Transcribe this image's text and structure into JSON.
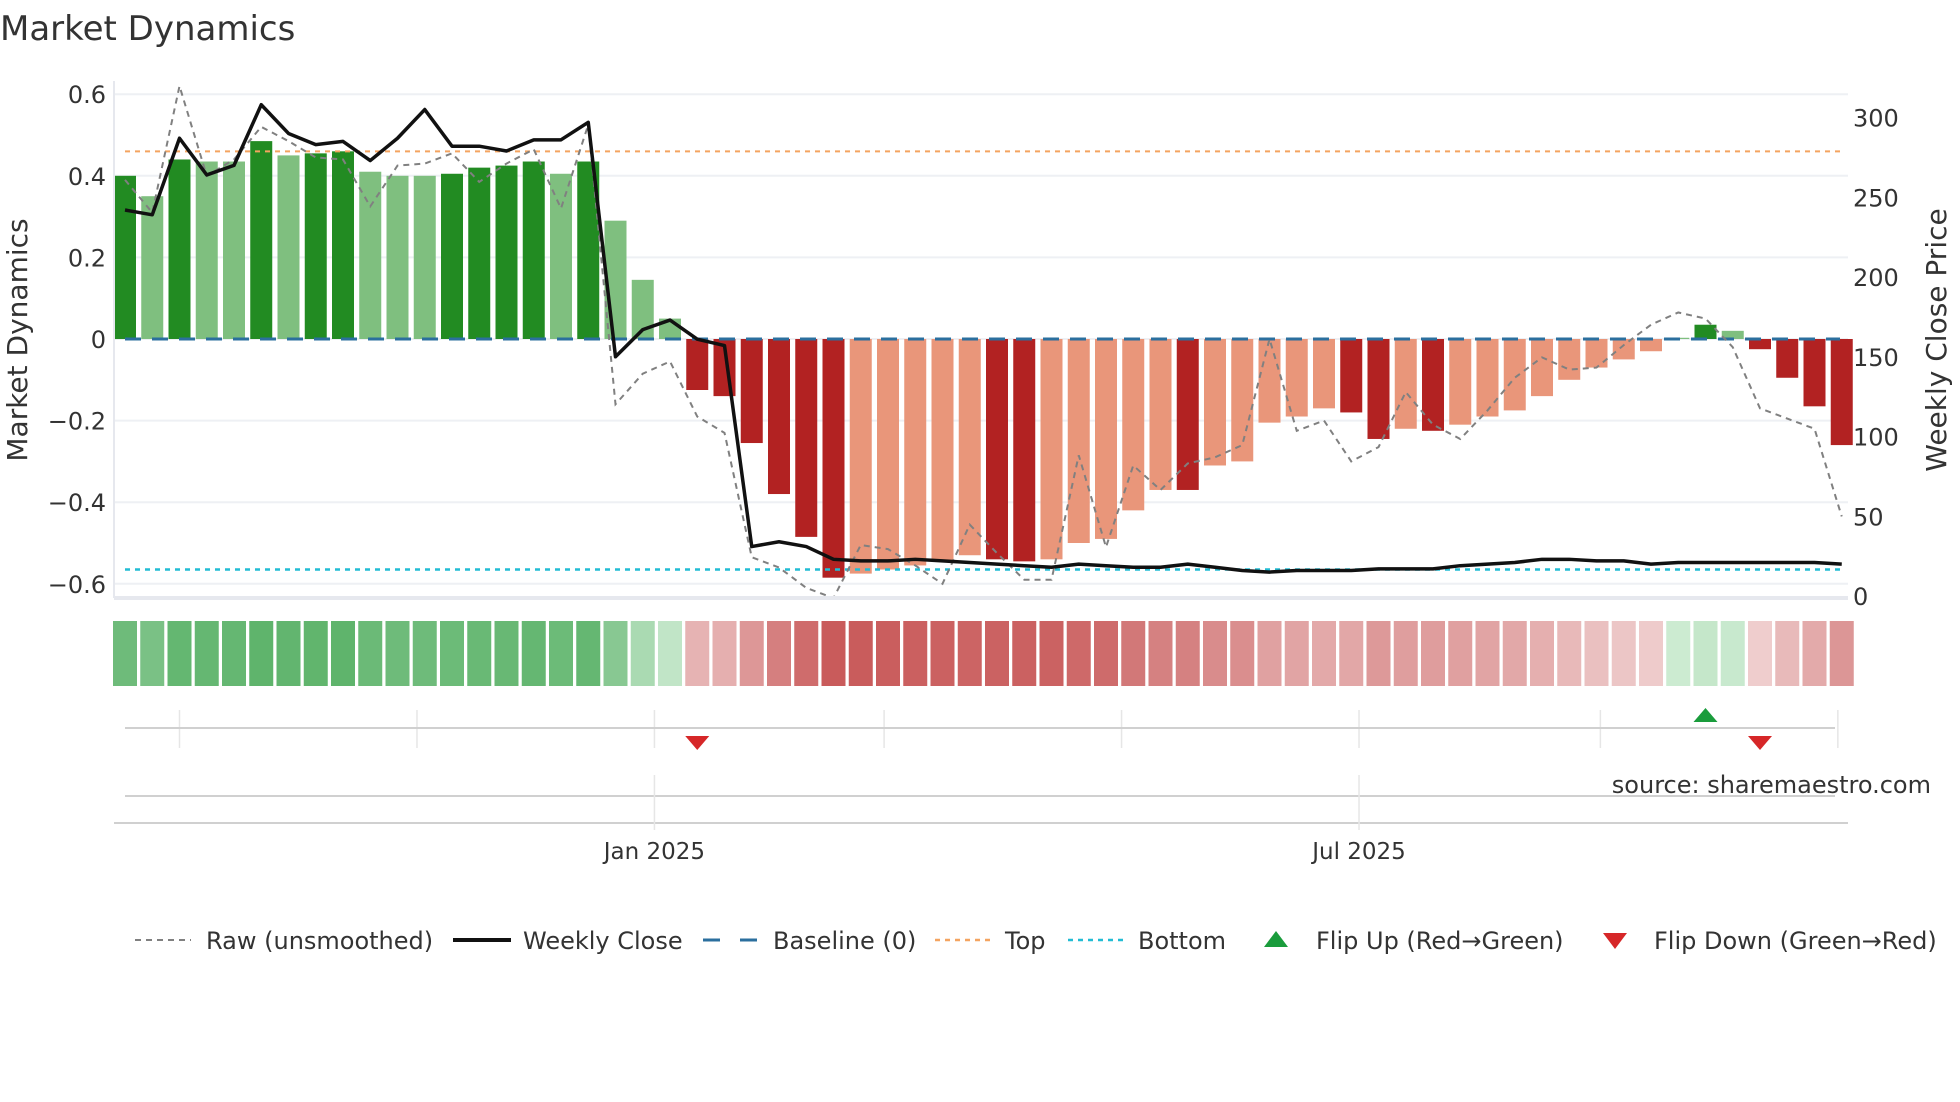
{
  "chart_data": {
    "type": "bar",
    "title": "Market Dynamics",
    "ylabel": "Market Dynamics",
    "y2label": "Weekly Close Price",
    "ylim": [
      -0.63,
      0.63
    ],
    "y2lim": [
      0,
      325
    ],
    "yticks": [
      -0.6,
      -0.4,
      -0.2,
      0,
      0.2,
      0.4,
      0.6
    ],
    "yticklabels": [
      "−0.6",
      "−0.4",
      "−0.2",
      "0",
      "0.2",
      "0.4",
      "0.6"
    ],
    "y2ticks": [
      0,
      50,
      100,
      150,
      200,
      250,
      300
    ],
    "y2ticklabels": [
      "0",
      "50",
      "100",
      "150",
      "200",
      "250",
      "300"
    ],
    "grid": true,
    "x": [
      "2024-08-18",
      "2024-08-25",
      "2024-09-01",
      "2024-09-08",
      "2024-09-15",
      "2024-09-22",
      "2024-09-29",
      "2024-10-06",
      "2024-10-13",
      "2024-10-20",
      "2024-10-27",
      "2024-11-03",
      "2024-11-10",
      "2024-11-17",
      "2024-11-24",
      "2024-12-01",
      "2024-12-08",
      "2024-12-15",
      "2024-12-22",
      "2024-12-29",
      "2025-01-05",
      "2025-01-12",
      "2025-01-19",
      "2025-01-26",
      "2025-02-02",
      "2025-02-09",
      "2025-02-16",
      "2025-02-23",
      "2025-03-02",
      "2025-03-09",
      "2025-03-16",
      "2025-03-23",
      "2025-03-30",
      "2025-04-06",
      "2025-04-13",
      "2025-04-20",
      "2025-04-27",
      "2025-05-04",
      "2025-05-11",
      "2025-05-18",
      "2025-05-25",
      "2025-06-01",
      "2025-06-08",
      "2025-06-15",
      "2025-06-22",
      "2025-06-29",
      "2025-07-06",
      "2025-07-13",
      "2025-07-20",
      "2025-07-27",
      "2025-08-03",
      "2025-08-10",
      "2025-08-17",
      "2025-08-24",
      "2025-08-31",
      "2025-09-07",
      "2025-09-14",
      "2025-09-21",
      "2025-09-28",
      "2025-10-05",
      "2025-10-12",
      "2025-10-19",
      "2025-10-26",
      "2025-11-02"
    ],
    "market_dynamics": [
      0.4,
      0.35,
      0.44,
      0.435,
      0.435,
      0.485,
      0.45,
      0.455,
      0.46,
      0.41,
      0.4,
      0.4,
      0.405,
      0.42,
      0.425,
      0.435,
      0.405,
      0.435,
      0.29,
      0.145,
      0.05,
      -0.125,
      -0.14,
      -0.255,
      -0.38,
      -0.485,
      -0.585,
      -0.575,
      -0.565,
      -0.555,
      -0.545,
      -0.53,
      -0.54,
      -0.545,
      -0.54,
      -0.5,
      -0.49,
      -0.42,
      -0.37,
      -0.37,
      -0.31,
      -0.3,
      -0.205,
      -0.19,
      -0.17,
      -0.18,
      -0.245,
      -0.22,
      -0.225,
      -0.21,
      -0.19,
      -0.175,
      -0.14,
      -0.1,
      -0.07,
      -0.05,
      -0.03,
      0.003,
      0.035,
      0.02,
      -0.025,
      -0.095,
      -0.165,
      -0.26
    ],
    "bar_shade": [
      "dark",
      "light",
      "dark",
      "light",
      "light",
      "dark",
      "light",
      "dark",
      "dark",
      "light",
      "light",
      "light",
      "dark",
      "dark",
      "dark",
      "dark",
      "light",
      "dark",
      "light",
      "light",
      "light",
      "dark",
      "dark",
      "dark",
      "dark",
      "dark",
      "dark",
      "light",
      "light",
      "light",
      "light",
      "light",
      "dark",
      "dark",
      "light",
      "light",
      "light",
      "light",
      "light",
      "dark",
      "light",
      "light",
      "light",
      "light",
      "light",
      "dark",
      "dark",
      "light",
      "dark",
      "light",
      "light",
      "light",
      "light",
      "light",
      "light",
      "light",
      "light",
      "light",
      "dark",
      "light",
      "dark",
      "dark",
      "dark",
      "dark"
    ],
    "raw_unsmoothed": [
      0.39,
      0.31,
      0.62,
      0.4,
      0.44,
      0.52,
      0.485,
      0.445,
      0.44,
      0.325,
      0.425,
      0.43,
      0.455,
      0.385,
      0.43,
      0.465,
      0.32,
      0.525,
      -0.16,
      -0.085,
      -0.055,
      -0.19,
      -0.23,
      -0.535,
      -0.56,
      -0.61,
      -0.635,
      -0.505,
      -0.515,
      -0.555,
      -0.6,
      -0.455,
      -0.525,
      -0.59,
      -0.59,
      -0.285,
      -0.51,
      -0.31,
      -0.37,
      -0.305,
      -0.29,
      -0.26,
      0.0,
      -0.225,
      -0.2,
      -0.3,
      -0.265,
      -0.13,
      -0.21,
      -0.245,
      -0.175,
      -0.095,
      -0.045,
      -0.075,
      -0.07,
      -0.015,
      0.035,
      0.065,
      0.05,
      -0.02,
      -0.17,
      -0.195,
      -0.22,
      -0.435
    ],
    "weekly_close": [
      242,
      239,
      287,
      264,
      270,
      308,
      290,
      283,
      285,
      273,
      287,
      305,
      282,
      282,
      279,
      286,
      286,
      297,
      150,
      167,
      173,
      161,
      157,
      31,
      34,
      31,
      23,
      22,
      22,
      23,
      22,
      21,
      20,
      19,
      18,
      20,
      19,
      18,
      18,
      20,
      18,
      16,
      15,
      16,
      16,
      16,
      17,
      17,
      17,
      19,
      20,
      21,
      23,
      23,
      22,
      22,
      20,
      21,
      21,
      21,
      21,
      21,
      21,
      20
    ],
    "baseline": 0,
    "top": 0.46,
    "bottom": -0.565,
    "flips": [
      {
        "date": "2025-01-12",
        "direction": "down"
      },
      {
        "date": "2025-09-28",
        "direction": "up"
      },
      {
        "date": "2025-10-12",
        "direction": "down"
      }
    ],
    "xgrid_dates": [
      "2024-09-01",
      "2024-11-01",
      "2025-01-01",
      "2025-03-01",
      "2025-05-01",
      "2025-07-01",
      "2025-09-01",
      "2025-11-01"
    ],
    "xticks": [
      {
        "date": "2025-01-01",
        "label": "Jan 2025"
      },
      {
        "date": "2025-07-01",
        "label": "Jul 2025"
      }
    ],
    "legend": {
      "placement": "bottom",
      "entries": [
        {
          "key": "raw",
          "label": "Raw (unsmoothed)"
        },
        {
          "key": "close",
          "label": "Weekly Close"
        },
        {
          "key": "baseline",
          "label": "Baseline (0)"
        },
        {
          "key": "top",
          "label": "Top"
        },
        {
          "key": "bottom",
          "label": "Bottom"
        },
        {
          "key": "flipup",
          "label": "Flip Up (Red→Green)"
        },
        {
          "key": "flipdown",
          "label": "Flip Down (Green→Red)"
        }
      ]
    },
    "source": "source: sharemaestro.com",
    "colors": {
      "green_dark": "#228b22",
      "green_light": "#7fbf7f",
      "red_dark": "#b22222",
      "red_light": "#e9967a",
      "raw": "#808080",
      "close": "#111111",
      "baseline": "#2b6f9e",
      "top": "#f4a460",
      "bottom": "#22bcd4",
      "flip_up": "#1a9c3c",
      "flip_down": "#d62728"
    }
  }
}
